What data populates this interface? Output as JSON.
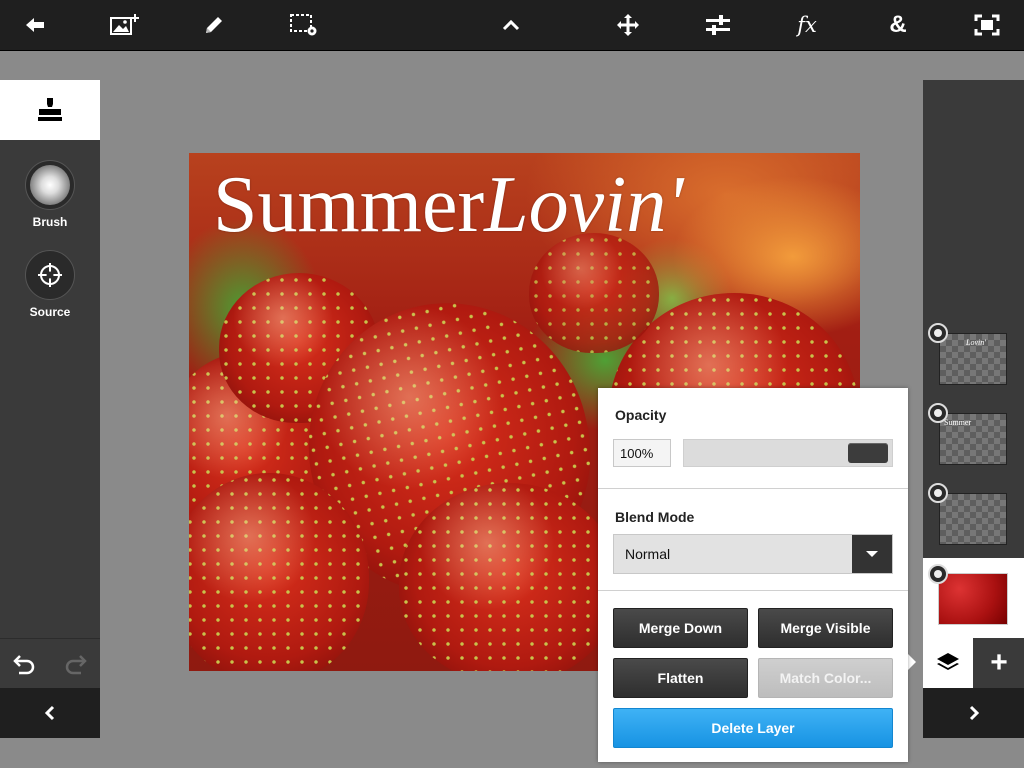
{
  "toolbar": {
    "icons": [
      "back-arrow-icon",
      "add-image-icon",
      "pencil-icon",
      "selection-settings-icon",
      "chevron-up-icon",
      "move-icon",
      "adjustments-icon",
      "fx-icon",
      "ampersand-icon",
      "fit-screen-icon"
    ],
    "fx_label": "fx",
    "amp_label": "&"
  },
  "left_panel": {
    "active_tool": "clone-stamp-icon",
    "tools": [
      {
        "label": "Brush"
      },
      {
        "label": "Source"
      }
    ]
  },
  "canvas": {
    "title_regular": "Summer",
    "title_italic": "Lovin'"
  },
  "layers": {
    "items": [
      {
        "thumb_text": "Lovin'"
      },
      {
        "thumb_text": "Summer"
      },
      {
        "thumb_text": ""
      },
      {
        "thumb_text": ""
      }
    ],
    "add_label": "+"
  },
  "popup": {
    "opacity_label": "Opacity",
    "opacity_value": "100%",
    "opacity_level": 1.0,
    "blend_label": "Blend Mode",
    "blend_value": "Normal",
    "buttons": {
      "merge_down": "Merge Down",
      "merge_visible": "Merge Visible",
      "flatten": "Flatten",
      "match_color": "Match Color...",
      "delete_layer": "Delete Layer"
    }
  },
  "colors": {
    "toolbar_bg": "#1f1f1f",
    "panel_bg": "#3a3a3a",
    "workspace_bg": "#8a8a8a",
    "delete_button": "#1793e3"
  }
}
